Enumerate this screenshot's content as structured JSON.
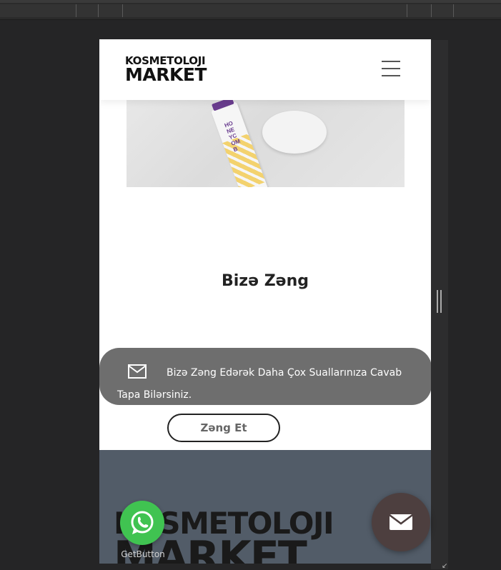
{
  "header": {
    "logo_top": "KOSMETOLOJI",
    "logo_bottom": "MARKET",
    "menu_icon": "hamburger-menu-icon"
  },
  "product_image": {
    "bottle_label": "HONEYCOMB"
  },
  "contact_section": {
    "title": "Bizə Zəng",
    "info_icon": "envelope-icon",
    "info_text": "Bizə Zəng Edərək Daha Çox Suallarınıza Cavab Tapa Bilərsiniz.",
    "call_button_label": "Zəng Et"
  },
  "footer": {
    "logo_top": "KOSMETOLOJI",
    "logo_bottom": "MARKET"
  },
  "floating": {
    "whatsapp_icon": "whatsapp-icon",
    "whatsapp_label": "GetButton",
    "mail_icon": "envelope-icon"
  },
  "colors": {
    "info_pill": "#6e6e6e",
    "footer_bg": "#525c68",
    "whatsapp_green": "#40c351",
    "mail_button": "#4d3f3f"
  }
}
